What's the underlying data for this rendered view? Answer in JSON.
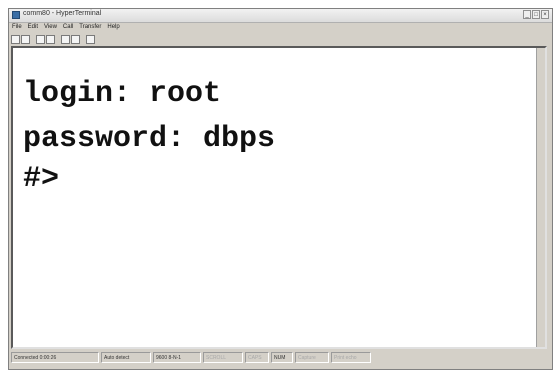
{
  "window": {
    "title": "comm80 - HyperTerminal"
  },
  "menu": [
    "File",
    "Edit",
    "View",
    "Call",
    "Transfer",
    "Help"
  ],
  "toolbar": [
    {
      "name": "new-connection-icon"
    },
    {
      "name": "open-icon"
    },
    {
      "name": "disconnect-icon"
    },
    {
      "name": "dial-icon"
    },
    {
      "name": "send-icon"
    },
    {
      "name": "receive-icon"
    },
    {
      "name": "properties-icon"
    }
  ],
  "terminal": {
    "lines": [
      "login: root",
      "password: dbps",
      "#>"
    ]
  },
  "status": {
    "connected": "Connected 0:00:26",
    "detect": "Auto detect",
    "settings": "9600 8-N-1",
    "scroll": "SCROLL",
    "caps": "CAPS",
    "num": "NUM",
    "capture": "Capture",
    "print_echo": "Print echo"
  }
}
